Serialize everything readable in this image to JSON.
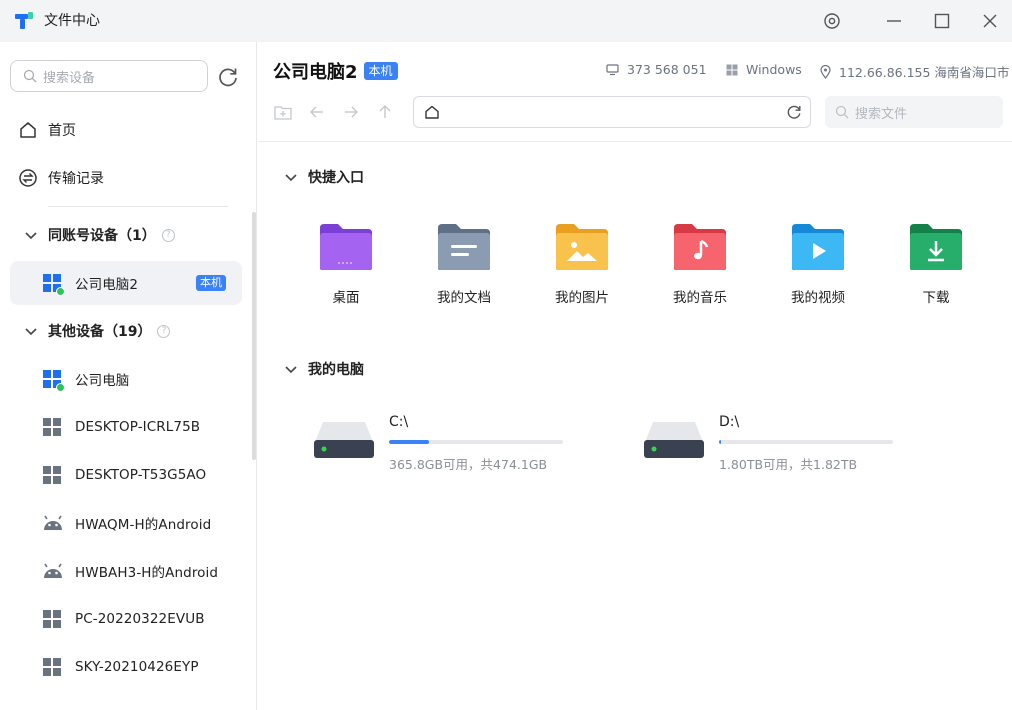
{
  "app": {
    "title": "文件中心"
  },
  "sidebar": {
    "search_placeholder": "搜索设备",
    "nav": [
      {
        "label": "首页"
      },
      {
        "label": "传输记录"
      }
    ],
    "groups": [
      {
        "label": "同账号设备（1）"
      },
      {
        "label": "其他设备（19）"
      }
    ],
    "devices": [
      {
        "name": "公司电脑2",
        "badge": "本机",
        "type": "windows",
        "online": true,
        "selected": true
      },
      {
        "name": "公司电脑",
        "type": "windows",
        "online": true
      },
      {
        "name": "DESKTOP-ICRL75B",
        "type": "windows-offline"
      },
      {
        "name": "DESKTOP-T53G5AO",
        "type": "windows-offline"
      },
      {
        "name": "HWAQM-H的Android",
        "type": "android"
      },
      {
        "name": "HWBAH3-H的Android",
        "type": "android"
      },
      {
        "name": "PC-20220322EVUB",
        "type": "windows-offline"
      },
      {
        "name": "SKY-20210426EYP",
        "type": "windows-offline"
      }
    ]
  },
  "header": {
    "device_title": "公司电脑2",
    "badge": "本机",
    "device_id": "373 568 051",
    "os": "Windows",
    "ip_location": "112.66.86.155 海南省海口市",
    "path_value": "",
    "file_search_placeholder": "搜索文件"
  },
  "quick_access": {
    "label": "快捷入口",
    "items": [
      {
        "label": "桌面",
        "icon": "desktop-folder-icon",
        "color": "#9b5de5"
      },
      {
        "label": "我的文档",
        "icon": "documents-folder-icon",
        "color": "#7d8fa8"
      },
      {
        "label": "我的图片",
        "icon": "pictures-folder-icon",
        "color": "#f5b335"
      },
      {
        "label": "我的音乐",
        "icon": "music-folder-icon",
        "color": "#f0545e"
      },
      {
        "label": "我的视频",
        "icon": "video-folder-icon",
        "color": "#2eabf0"
      },
      {
        "label": "下载",
        "icon": "download-folder-icon",
        "color": "#22a565"
      }
    ]
  },
  "my_computer": {
    "label": "我的电脑",
    "drives": [
      {
        "name": "C:\\",
        "used_fraction": 0.228,
        "info": "365.8GB可用，共474.1GB"
      },
      {
        "name": "D:\\",
        "used_fraction": 0.011,
        "info": "1.80TB可用，共1.82TB"
      }
    ]
  },
  "colors": {
    "accent": "#3b82f6",
    "online": "#31c15a"
  }
}
